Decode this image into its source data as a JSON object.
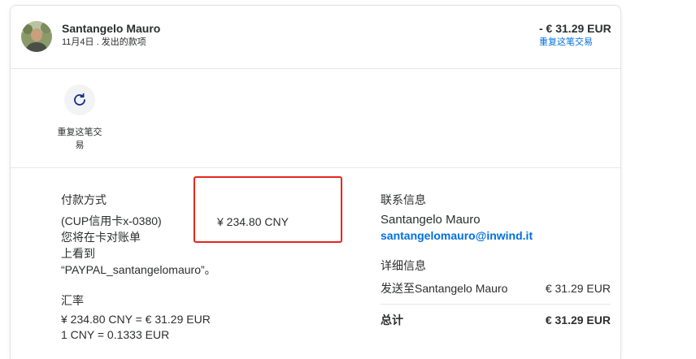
{
  "transaction": {
    "counterparty_name": "Santangelo Mauro",
    "subtitle": "11月4日 . 发出的款项",
    "amount": "- € 31.29 EUR",
    "repeat_link": "重复这笔交易"
  },
  "actions": {
    "repeat_label": "重复这笔交易",
    "repeat_icon": "refresh-icon"
  },
  "payment_method": {
    "heading": "付款方式",
    "card": "(CUP信用卡x-0380)",
    "statement_note_lines": [
      "您将在卡对账单",
      "上看到",
      "“PAYPAL_santangelomauro”。"
    ],
    "amount": "¥ 234.80 CNY"
  },
  "exchange_rate": {
    "heading": "汇率",
    "conversion": "¥ 234.80 CNY = € 31.29 EUR",
    "rate": "1 CNY = 0.1333 EUR"
  },
  "contact": {
    "heading": "联系信息",
    "name": "Santangelo Mauro",
    "email": "santangelomauro@inwind.it"
  },
  "details": {
    "heading": "详细信息",
    "rows": [
      {
        "label": "发送至Santangelo Mauro",
        "value": "€ 31.29 EUR"
      }
    ],
    "total_label": "总计",
    "total_value": "€ 31.29 EUR"
  },
  "colors": {
    "text": "#2c2e2f",
    "link": "#0070e0",
    "highlight": "#e3261f",
    "icon": "#142c8e"
  }
}
